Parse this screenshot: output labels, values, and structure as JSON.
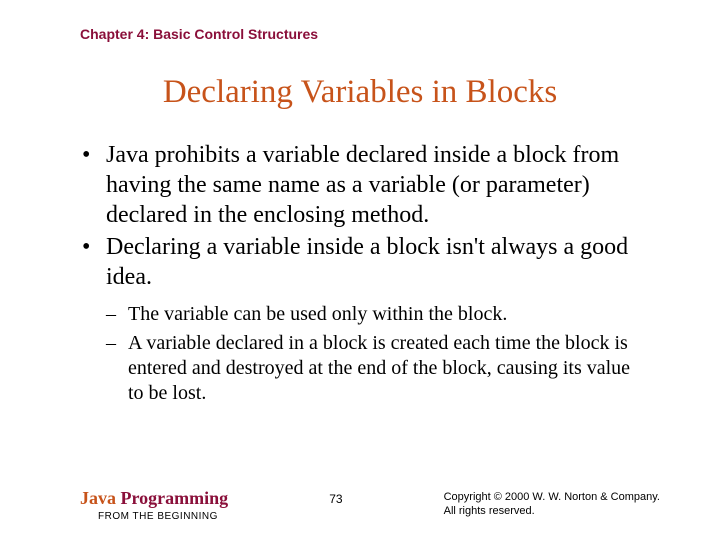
{
  "chapter_header": "Chapter 4: Basic Control Structures",
  "title": "Declaring Variables in Blocks",
  "bullets": [
    "Java prohibits a variable declared inside a block from having the same name as a variable (or parameter) declared in the enclosing method.",
    "Declaring a variable inside a block isn't always a good idea."
  ],
  "sub_bullets": [
    "The variable can be used only within the block.",
    "A variable declared in a block is created each time the block is entered and destroyed at the end of the block, causing its value to be lost."
  ],
  "footer": {
    "book_java": "Java",
    "book_programming": " Programming",
    "book_sub": "FROM THE BEGINNING",
    "page": "73",
    "copyright_line1": "Copyright © 2000 W. W. Norton & Company.",
    "copyright_line2": "All rights reserved."
  }
}
